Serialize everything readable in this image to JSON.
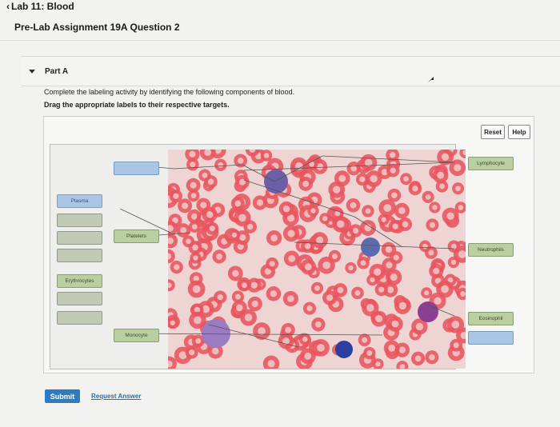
{
  "nav": {
    "back_label": "Lab 11: Blood"
  },
  "page": {
    "title": "Pre-Lab Assignment 19A Question 2"
  },
  "part": {
    "label": "Part A"
  },
  "instructions": {
    "line1": "Complete the labeling activity by identifying the following components of blood.",
    "line2": "Drag the appropriate labels to their respective targets."
  },
  "toolbar": {
    "reset_label": "Reset",
    "help_label": "Help"
  },
  "labels": {
    "plasma": "Plasma",
    "erythrocytes": "Erythrocytes",
    "platelets": "Platelets",
    "monocyte": "Monocyte",
    "lymphocyte": "Lymphocyte",
    "neutrophils": "Neutrophils",
    "eosinophil": "Eosinophil"
  },
  "footer": {
    "submit_label": "Submit",
    "request_answer_label": "Request Answer"
  },
  "colors": {
    "accent": "#2f7bbf",
    "label_blue": "#a9c7e5",
    "label_green": "#b9cfa0",
    "rbc": "#e8555f"
  }
}
